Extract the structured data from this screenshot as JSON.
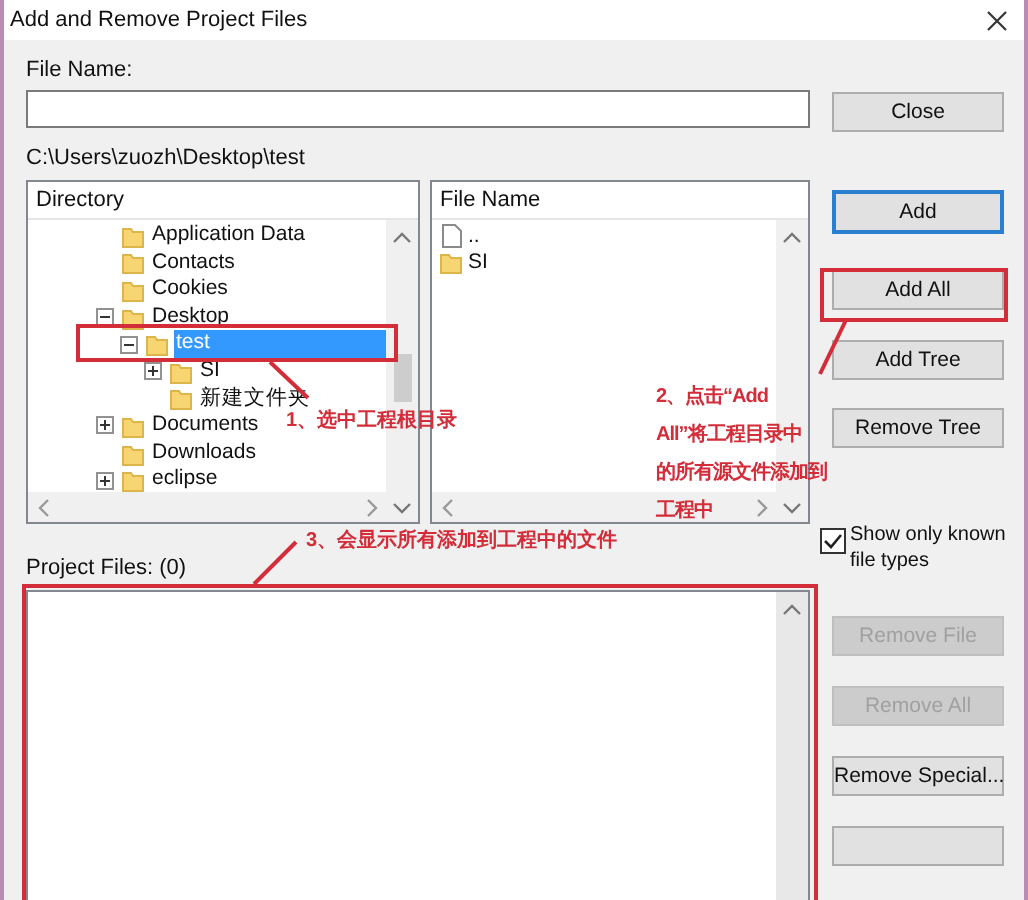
{
  "window": {
    "title": "Add and Remove Project Files"
  },
  "file_name": {
    "label": "File Name:"
  },
  "current_path": "C:\\Users\\zuozh\\Desktop\\test",
  "directory": {
    "header": "Directory",
    "items": [
      {
        "name": "Application Data",
        "selected": false
      },
      {
        "name": "Contacts",
        "selected": false
      },
      {
        "name": "Cookies",
        "selected": false
      },
      {
        "name": "Desktop",
        "selected": false,
        "expanded": true,
        "children": [
          {
            "name": "test",
            "selected": true,
            "expanded": true,
            "children": [
              {
                "name": "SI",
                "selected": false,
                "expanded": false
              },
              {
                "name": "新建文件夹",
                "selected": false
              }
            ]
          }
        ]
      },
      {
        "name": "Documents",
        "selected": false,
        "expanded": false
      },
      {
        "name": "Downloads",
        "selected": false
      },
      {
        "name": "eclipse",
        "selected": false,
        "expanded": false
      }
    ]
  },
  "files": {
    "header": "File Name",
    "items": [
      {
        "name": "..",
        "kind": "parent"
      },
      {
        "name": "SI",
        "kind": "folder"
      }
    ]
  },
  "project_files": {
    "label": "Project Files: (0)"
  },
  "filter": {
    "label": "Show only known file types",
    "checked": true
  },
  "buttons": [
    {
      "label": "Close",
      "disabled": false,
      "default": false
    },
    {
      "label": "Add",
      "disabled": false,
      "default": true
    },
    {
      "label": "Add All",
      "disabled": false,
      "default": false
    },
    {
      "label": "Add Tree",
      "disabled": false,
      "default": false
    },
    {
      "label": "Remove Tree",
      "disabled": false,
      "default": false
    },
    {
      "kind": "checkbox"
    },
    {
      "label": "Remove File",
      "disabled": true,
      "default": false
    },
    {
      "label": "Remove All",
      "disabled": true,
      "default": false
    },
    {
      "label": "Remove Special...",
      "disabled": false,
      "default": false
    },
    {
      "disabled": false,
      "default": false
    }
  ],
  "annotations": [
    {
      "kind": "frame"
    },
    {
      "kind": "frame"
    },
    {
      "kind": "frame"
    },
    {
      "kind": "callout",
      "text": "1、选中工程根目录"
    },
    {
      "kind": "callout",
      "lines": [
        "2、点击“Add",
        "All”将工程目录中",
        "的所有源文件添加到",
        "工程中"
      ]
    },
    {
      "kind": "callout",
      "text": "3、会显示所有添加到工程中的文件"
    }
  ]
}
